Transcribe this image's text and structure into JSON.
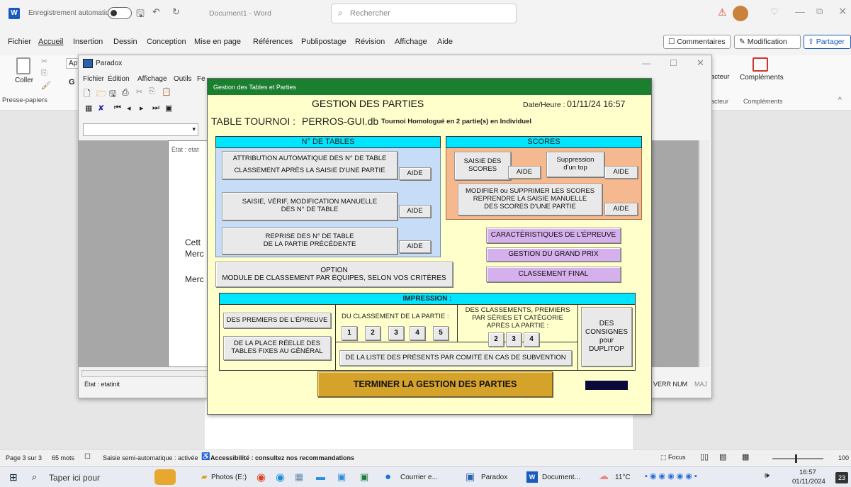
{
  "word": {
    "autosave": "Enregistrement automatique",
    "doc_title": "Document1 - Word",
    "search": "Rechercher",
    "menu": [
      "Fichier",
      "Accueil",
      "Insertion",
      "Dessin",
      "Conception",
      "Mise en page",
      "Références",
      "Publipostage",
      "Révision",
      "Affichage",
      "Aide"
    ],
    "comments": "Commentaires",
    "modification": "Modification",
    "share": "Partager",
    "coller": "Coller",
    "presse_papiers": "Presse-papiers",
    "font_abbr": "Apt",
    "bold_g": "G",
    "complements": "Compléments",
    "redacteur": "acteur",
    "status": {
      "page": "Page 3 sur 3",
      "words": "65 mots",
      "autocorrect": "Saisie semi-automatique : activée",
      "access": "Accessibilité : consultez nos recommandations",
      "focus": "Focus",
      "zoom": "100"
    }
  },
  "paradox": {
    "title": "Paradox",
    "menu": [
      "Fichier",
      "Édition",
      "Affichage",
      "Outils",
      "Fe"
    ],
    "etat_label": "État : etatinit",
    "verr_num": "VERR NUM",
    "maj": "MAJ",
    "doc_text": {
      "cett": "Cett",
      "merc1": "Merc",
      "merc2": "Merc",
      "etat_tab": "État : etat"
    }
  },
  "dialog": {
    "window_title": "Gestion des Tables et Parties",
    "heading": "GESTION DES PARTIES",
    "datetime_label": "Date/Heure :",
    "datetime_value": "01/11/24 16:57",
    "table_label": "TABLE TOURNOI :",
    "table_name": "PERROS-GUI.db",
    "tournoi_desc": "Tournoi Homologué en 2 partie(s) en Individuel",
    "tables_header": "N° DE TABLES",
    "btn_attrib_l1": "ATTRIBUTION AUTOMATIQUE DES N° DE TABLE",
    "btn_attrib_l2": "CLASSEMENT APRÈS LA SAISIE D'UNE PARTIE",
    "btn_saisie_l1": "SAISIE, VÉRIF, MODIFICATION MANUELLE",
    "btn_saisie_l2": "DES N° DE TABLE",
    "btn_reprise_l1": "REPRISE DES N° DE TABLE",
    "btn_reprise_l2": "DE LA PARTIE PRÉCÉDENTE",
    "aide": "AIDE",
    "scores_header": "SCORES",
    "btn_saisie_scores_l1": "SAISIE DES",
    "btn_saisie_scores_l2": "SCORES",
    "btn_suppr_l1": "Suppression",
    "btn_suppr_l2": "d'un top",
    "btn_modif_l1": "MODIFIER ou SUPPRIMER LES SCORES",
    "btn_modif_l2": "REPRENDRE LA SAISIE MANUELLE",
    "btn_modif_l3": "DES SCORES D'UNE PARTIE",
    "caract": "CARACTÉRISTIQUES DE L'ÉPREUVE",
    "grand_prix": "GESTION DU GRAND PRIX",
    "classement_final": "CLASSEMENT FINAL",
    "option_l1": "OPTION",
    "option_l2": "MODULE DE CLASSEMENT PAR ÉQUIPES, SELON VOS CRITÈRES",
    "impression_header": "IMPRESSION :",
    "btn_premiers": "DES PREMIERS DE L'ÉPREUVE",
    "btn_place_l1": "DE LA PLACE RÉELLE DES",
    "btn_place_l2": "TABLES FIXES AU GÉNÉRAL",
    "classement_partie": "DU CLASSEMENT DE LA PARTIE :",
    "parts": [
      "1",
      "2",
      "3",
      "4",
      "5"
    ],
    "classements_l1": "DES CLASSEMENTS, PREMIERS",
    "classements_l2": "PAR SÉRIES ET CATÉGORIE",
    "classements_l3": "APRÈS LA PARTIE :",
    "series_parts": [
      "2",
      "3",
      "4"
    ],
    "consignes_l1": "DES",
    "consignes_l2": "CONSIGNES",
    "consignes_l3": "pour",
    "consignes_l4": "DUPLITOP",
    "liste_presents": "DE LA LISTE DES PRÉSENTS PAR COMITÉ EN CAS DE SUBVENTION",
    "terminer": "TERMINER LA GESTION DES PARTIES"
  },
  "taskbar": {
    "search": "Taper ici pour",
    "photos": "Photos (E:)",
    "courrier": "Courrier e...",
    "paradox": "Paradox",
    "document": "Document...",
    "temp": "11°C",
    "time": "16:57",
    "date": "01/11/2024",
    "badge": "23"
  },
  "colors": {
    "dialog_bg": "#ffffcc",
    "green_title": "#1a7f2e",
    "cyan": "#00e5ff",
    "blue_panel": "#c6dcf7",
    "orange_panel": "#f6b88e",
    "violet": "#d5b0ec",
    "terminer": "#d6a32a",
    "word_blue": "#185abd"
  }
}
